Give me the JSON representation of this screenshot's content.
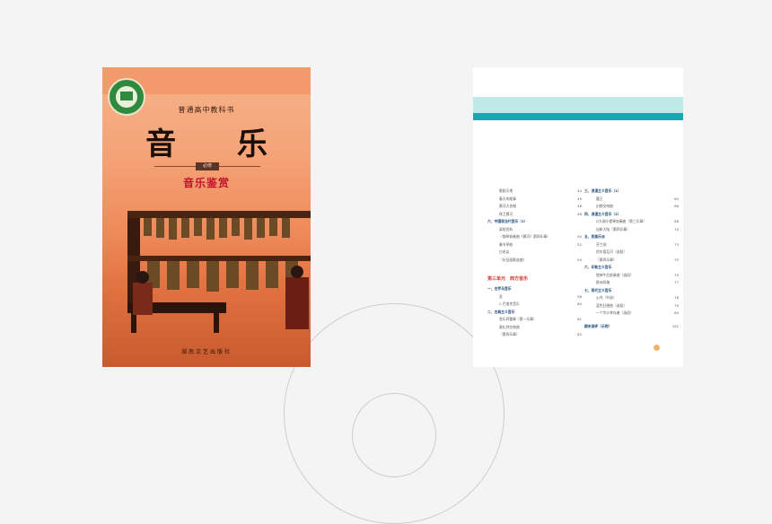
{
  "cover": {
    "series": "普通高中教科书",
    "title": "音 乐",
    "badge": "必修",
    "subtitle": "音乐鉴赏",
    "publisher": "湖南文艺出版社",
    "colors": {
      "top": "#f6b48a",
      "bottom": "#c85a2e",
      "subtitle": "#c3142c"
    }
  },
  "toc": {
    "accent_light": "#bfe9e6",
    "accent_dark": "#17a9b2",
    "left": [
      {
        "t": "歌剧天地",
        "p": "44",
        "kind": "sub"
      },
      {
        "t": "春天的故事",
        "p": "45",
        "kind": "sub"
      },
      {
        "t": "黄河大合唱",
        "p": "46",
        "kind": "sub"
      },
      {
        "t": "保卫黄河",
        "p": "48",
        "kind": "sub"
      },
      {
        "t": "六、中国现当代音乐（2）",
        "p": "",
        "kind": "head"
      },
      {
        "t": "梁祝赏析",
        "p": "",
        "kind": "sub"
      },
      {
        "t": "（钢琴协奏曲《黄河》第四乐章）",
        "p": "50",
        "kind": "sub"
      },
      {
        "t": "春节序曲",
        "p": "52",
        "kind": "sub"
      },
      {
        "t": "白毛女",
        "p": "",
        "kind": "sub"
      },
      {
        "t": "（长征组歌选曲）",
        "p": "54",
        "kind": "sub"
      },
      {
        "t": "",
        "p": "",
        "kind": "gap"
      },
      {
        "t": "第三单元　西方音乐",
        "p": "",
        "kind": "unit"
      },
      {
        "t": "一、古罗马音乐",
        "p": "",
        "kind": "head"
      },
      {
        "t": "圣",
        "p": "58",
        "kind": "sub"
      },
      {
        "t": "C.巴洛克音乐",
        "p": "60",
        "kind": "sub"
      },
      {
        "t": "二、古典主义音乐",
        "p": "",
        "kind": "head"
      },
      {
        "t": "弦乐四重奏（第一乐章）",
        "p": "61",
        "kind": "sub"
      },
      {
        "t": "莫扎特交响曲",
        "p": "",
        "kind": "sub"
      },
      {
        "t": "（第四乐章）",
        "p": "62",
        "kind": "sub"
      }
    ],
    "right": [
      {
        "t": "三、浪漫主义音乐（1）",
        "p": "",
        "kind": "head"
      },
      {
        "t": "魔王",
        "p": "64",
        "kind": "sub"
      },
      {
        "t": "幻想交响曲",
        "p": "66",
        "kind": "sub"
      },
      {
        "t": "四、浪漫主义音乐（2）",
        "p": "",
        "kind": "head"
      },
      {
        "t": "D大调小提琴协奏曲（第三乐章）",
        "p": "68",
        "kind": "sub"
      },
      {
        "t": "自新大陆（第四乐章）",
        "p": "70",
        "kind": "sub"
      },
      {
        "t": "五、民族乐派",
        "p": "",
        "kind": "head"
      },
      {
        "t": "芬兰颂",
        "p": "73",
        "kind": "sub"
      },
      {
        "t": "伏尔塔瓦河（选段）",
        "p": "",
        "kind": "sub"
      },
      {
        "t": "（第四乐章）",
        "p": "73",
        "kind": "sub"
      },
      {
        "t": "六、印象主义音乐",
        "p": "",
        "kind": "head"
      },
      {
        "t": "牧神午后前奏曲（选段）",
        "p": "75",
        "kind": "sub"
      },
      {
        "t": "欧洲风格",
        "p": "77",
        "kind": "sub"
      },
      {
        "t": "七、现代主义音乐",
        "p": "",
        "kind": "head"
      },
      {
        "t": "火鸟（节选）",
        "p": "78",
        "kind": "sub"
      },
      {
        "t": "蓝色狂想曲（选段）",
        "p": "79",
        "kind": "sub"
      },
      {
        "t": "一个华沙幸存者（选段）",
        "p": "80",
        "kind": "sub"
      },
      {
        "t": "",
        "p": "",
        "kind": "gap"
      },
      {
        "t": "期末测评（示例）",
        "p": "102",
        "kind": "head"
      }
    ]
  }
}
